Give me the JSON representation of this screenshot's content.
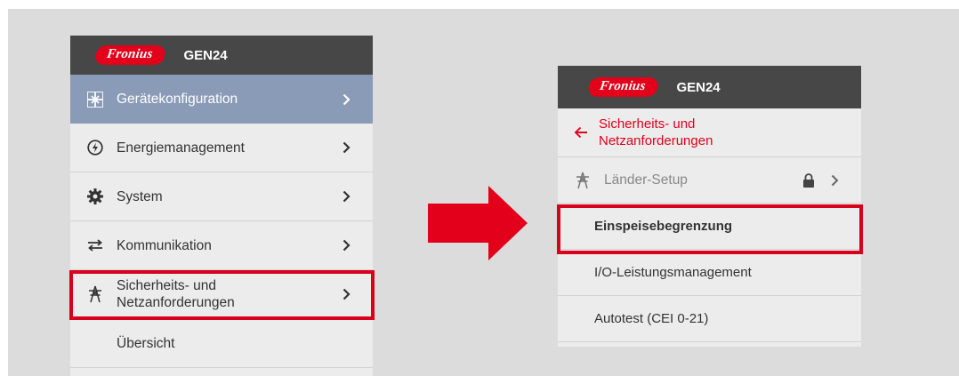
{
  "left_panel": {
    "logo": "Fronius",
    "model": "GEN24",
    "items": [
      {
        "label": "Gerätekonfiguration",
        "icon": "device-config-icon"
      },
      {
        "label": "Energiemanagement",
        "icon": "energy-icon"
      },
      {
        "label": "System",
        "icon": "gear-icon"
      },
      {
        "label": "Kommunikation",
        "icon": "communication-icon"
      },
      {
        "label_line1": "Sicherheits- und",
        "label_line2": "Netzanforderungen",
        "icon": "power-tower-icon"
      },
      {
        "label": "Übersicht"
      }
    ]
  },
  "right_panel": {
    "logo": "Fronius",
    "model": "GEN24",
    "back": {
      "label_line1": "Sicherheits- und",
      "label_line2": "Netzanforderungen"
    },
    "items": [
      {
        "label": "Länder-Setup",
        "icon": "power-tower-icon"
      },
      {
        "label": "Einspeisebegrenzung"
      },
      {
        "label": "I/O-Leistungsmanagement"
      },
      {
        "label": "Autotest (CEI 0-21)"
      }
    ]
  },
  "colors": {
    "brand_red": "#e2001a",
    "header_bg": "#474747",
    "active_bg": "#8a9bb7",
    "highlight": "#d9001b"
  }
}
